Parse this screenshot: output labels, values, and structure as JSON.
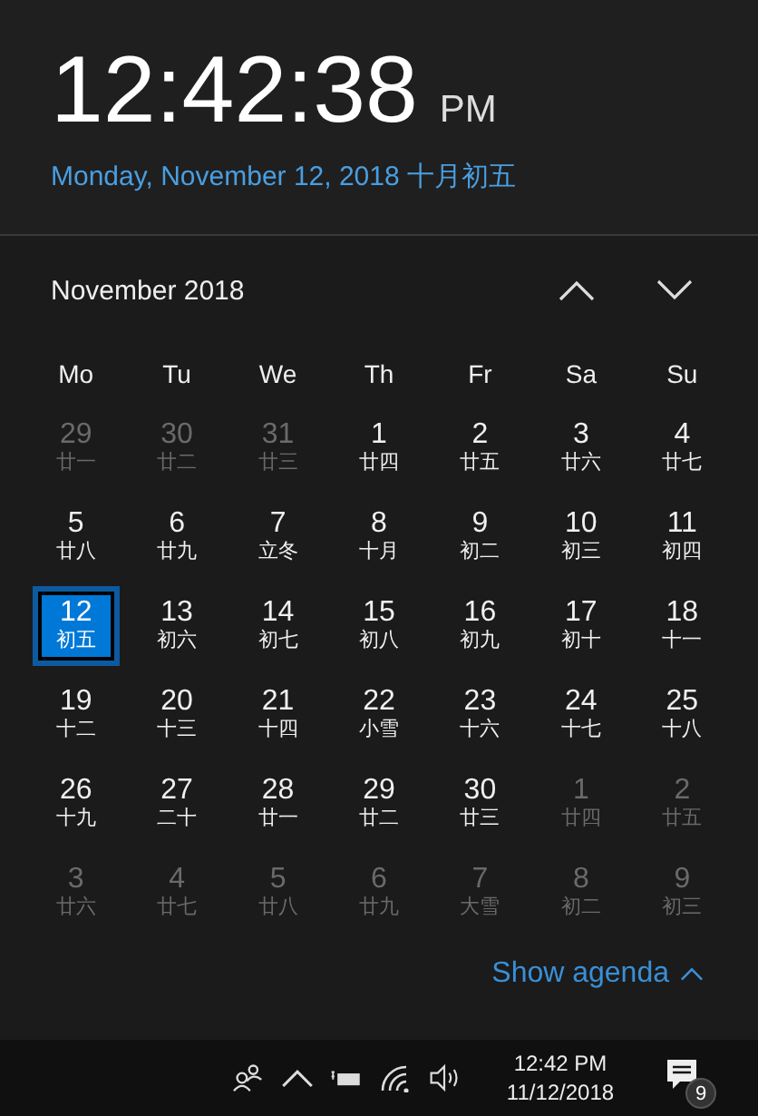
{
  "clock": {
    "time": "12:42:38",
    "period": "PM",
    "date": "Monday, November 12, 2018 十月初五"
  },
  "calendar": {
    "month": "November 2018",
    "weekdays": [
      "Mo",
      "Tu",
      "We",
      "Th",
      "Fr",
      "Sa",
      "Su"
    ],
    "weeks": [
      [
        {
          "day": "29",
          "lunar": "廿一",
          "in_month": false,
          "selected": false
        },
        {
          "day": "30",
          "lunar": "廿二",
          "in_month": false,
          "selected": false
        },
        {
          "day": "31",
          "lunar": "廿三",
          "in_month": false,
          "selected": false
        },
        {
          "day": "1",
          "lunar": "廿四",
          "in_month": true,
          "selected": false
        },
        {
          "day": "2",
          "lunar": "廿五",
          "in_month": true,
          "selected": false
        },
        {
          "day": "3",
          "lunar": "廿六",
          "in_month": true,
          "selected": false
        },
        {
          "day": "4",
          "lunar": "廿七",
          "in_month": true,
          "selected": false
        }
      ],
      [
        {
          "day": "5",
          "lunar": "廿八",
          "in_month": true,
          "selected": false
        },
        {
          "day": "6",
          "lunar": "廿九",
          "in_month": true,
          "selected": false
        },
        {
          "day": "7",
          "lunar": "立冬",
          "in_month": true,
          "selected": false
        },
        {
          "day": "8",
          "lunar": "十月",
          "in_month": true,
          "selected": false
        },
        {
          "day": "9",
          "lunar": "初二",
          "in_month": true,
          "selected": false
        },
        {
          "day": "10",
          "lunar": "初三",
          "in_month": true,
          "selected": false
        },
        {
          "day": "11",
          "lunar": "初四",
          "in_month": true,
          "selected": false
        }
      ],
      [
        {
          "day": "12",
          "lunar": "初五",
          "in_month": true,
          "selected": true
        },
        {
          "day": "13",
          "lunar": "初六",
          "in_month": true,
          "selected": false
        },
        {
          "day": "14",
          "lunar": "初七",
          "in_month": true,
          "selected": false
        },
        {
          "day": "15",
          "lunar": "初八",
          "in_month": true,
          "selected": false
        },
        {
          "day": "16",
          "lunar": "初九",
          "in_month": true,
          "selected": false
        },
        {
          "day": "17",
          "lunar": "初十",
          "in_month": true,
          "selected": false
        },
        {
          "day": "18",
          "lunar": "十一",
          "in_month": true,
          "selected": false
        }
      ],
      [
        {
          "day": "19",
          "lunar": "十二",
          "in_month": true,
          "selected": false
        },
        {
          "day": "20",
          "lunar": "十三",
          "in_month": true,
          "selected": false
        },
        {
          "day": "21",
          "lunar": "十四",
          "in_month": true,
          "selected": false
        },
        {
          "day": "22",
          "lunar": "小雪",
          "in_month": true,
          "selected": false
        },
        {
          "day": "23",
          "lunar": "十六",
          "in_month": true,
          "selected": false
        },
        {
          "day": "24",
          "lunar": "十七",
          "in_month": true,
          "selected": false
        },
        {
          "day": "25",
          "lunar": "十八",
          "in_month": true,
          "selected": false
        }
      ],
      [
        {
          "day": "26",
          "lunar": "十九",
          "in_month": true,
          "selected": false
        },
        {
          "day": "27",
          "lunar": "二十",
          "in_month": true,
          "selected": false
        },
        {
          "day": "28",
          "lunar": "廿一",
          "in_month": true,
          "selected": false
        },
        {
          "day": "29",
          "lunar": "廿二",
          "in_month": true,
          "selected": false
        },
        {
          "day": "30",
          "lunar": "廿三",
          "in_month": true,
          "selected": false
        },
        {
          "day": "1",
          "lunar": "廿四",
          "in_month": false,
          "selected": false
        },
        {
          "day": "2",
          "lunar": "廿五",
          "in_month": false,
          "selected": false
        }
      ],
      [
        {
          "day": "3",
          "lunar": "廿六",
          "in_month": false,
          "selected": false
        },
        {
          "day": "4",
          "lunar": "廿七",
          "in_month": false,
          "selected": false
        },
        {
          "day": "5",
          "lunar": "廿八",
          "in_month": false,
          "selected": false
        },
        {
          "day": "6",
          "lunar": "廿九",
          "in_month": false,
          "selected": false
        },
        {
          "day": "7",
          "lunar": "大雪",
          "in_month": false,
          "selected": false
        },
        {
          "day": "8",
          "lunar": "初二",
          "in_month": false,
          "selected": false
        },
        {
          "day": "9",
          "lunar": "初三",
          "in_month": false,
          "selected": false
        }
      ]
    ]
  },
  "agenda_link": "Show agenda",
  "taskbar": {
    "time": "12:42 PM",
    "date": "11/12/2018",
    "notification_count": "9"
  }
}
